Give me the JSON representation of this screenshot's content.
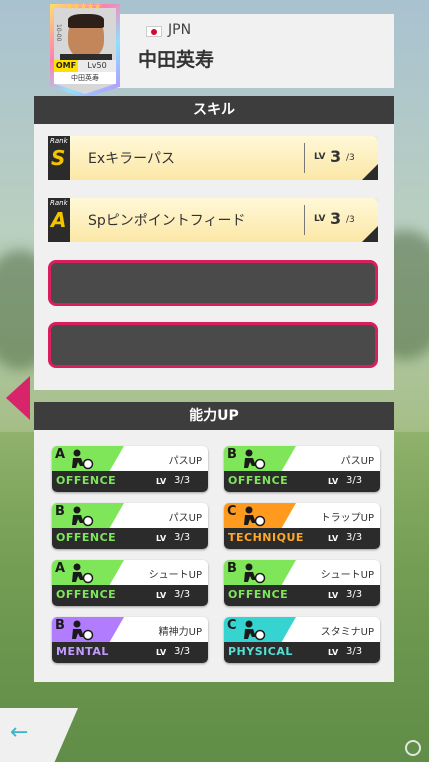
{
  "player": {
    "stars": "★★★★★",
    "number_side": "10-00",
    "position": "OMF",
    "level": "Lv50",
    "card_name": "中田英寿",
    "country": "JPN",
    "name": "中田英寿"
  },
  "skills": {
    "title": "スキル",
    "items": [
      {
        "rank_label": "Rank",
        "rank": "S",
        "name": "Exキラーパス",
        "lv_label": "LV",
        "lv": "3",
        "lv_max": "/3"
      },
      {
        "rank_label": "Rank",
        "rank": "A",
        "name": "Spピンポイントフィード",
        "lv_label": "LV",
        "lv": "3",
        "lv_max": "/3"
      }
    ]
  },
  "abilities": {
    "title": "能力UP",
    "items": [
      {
        "rank": "A",
        "name": "パスUP",
        "category": "OFFENCE",
        "lv_label": "LV",
        "lv": "3/3",
        "color": "#7fe65a",
        "cat_color": "#7fe65a",
        "icon": "pass-icon"
      },
      {
        "rank": "B",
        "name": "パスUP",
        "category": "OFFENCE",
        "lv_label": "LV",
        "lv": "3/3",
        "color": "#7fe65a",
        "cat_color": "#7fe65a",
        "icon": "pass-icon"
      },
      {
        "rank": "B",
        "name": "パスUP",
        "category": "OFFENCE",
        "lv_label": "LV",
        "lv": "3/3",
        "color": "#7fe65a",
        "cat_color": "#7fe65a",
        "icon": "pass-icon"
      },
      {
        "rank": "C",
        "name": "トラップUP",
        "category": "TECHNIQUE",
        "lv_label": "LV",
        "lv": "3/3",
        "color": "#ff9a1f",
        "cat_color": "#ffa726",
        "icon": "trap-icon"
      },
      {
        "rank": "A",
        "name": "シュートUP",
        "category": "OFFENCE",
        "lv_label": "LV",
        "lv": "3/3",
        "color": "#7fe65a",
        "cat_color": "#7fe65a",
        "icon": "shoot-icon"
      },
      {
        "rank": "B",
        "name": "シュートUP",
        "category": "OFFENCE",
        "lv_label": "LV",
        "lv": "3/3",
        "color": "#7fe65a",
        "cat_color": "#7fe65a",
        "icon": "shoot-icon"
      },
      {
        "rank": "B",
        "name": "精神力UP",
        "category": "MENTAL",
        "lv_label": "LV",
        "lv": "3/3",
        "color": "#b27cff",
        "cat_color": "#c39bff",
        "icon": "mental-icon"
      },
      {
        "rank": "C",
        "name": "スタミナUP",
        "category": "PHYSICAL",
        "lv_label": "LV",
        "lv": "3/3",
        "color": "#36d4d0",
        "cat_color": "#54e0d8",
        "icon": "stamina-icon"
      }
    ]
  },
  "nav": {
    "back_arrow": "←"
  },
  "colors": {
    "accent": "#d8246b",
    "panel": "#f0f0f0",
    "header_dark": "#3d3d3d"
  }
}
